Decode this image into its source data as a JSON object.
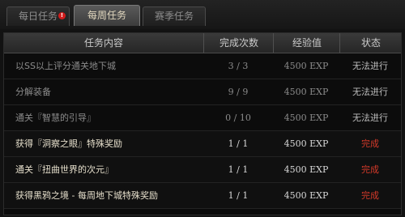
{
  "tabs": [
    {
      "label": "每日任务",
      "active": false,
      "badge": "!"
    },
    {
      "label": "每周任务",
      "active": true
    },
    {
      "label": "赛季任务",
      "active": false
    }
  ],
  "columns": [
    "任务内容",
    "完成次数",
    "经验值",
    "状态"
  ],
  "rows": [
    {
      "name": "以SS以上评分通关地下城",
      "progress": "3 / 3",
      "exp": "4500 EXP",
      "status": "无法进行",
      "state": "unavailable"
    },
    {
      "name": "分解装备",
      "progress": "9 / 9",
      "exp": "4500 EXP",
      "status": "无法进行",
      "state": "unavailable"
    },
    {
      "name": "通关『智慧的引导』",
      "progress": "0 / 10",
      "exp": "4500 EXP",
      "status": "无法进行",
      "state": "unavailable"
    },
    {
      "name": "获得『洞察之眼』特殊奖励",
      "progress": "1 / 1",
      "exp": "4500 EXP",
      "status": "完成",
      "state": "complete"
    },
    {
      "name": "通关『扭曲世界的次元』",
      "progress": "1 / 1",
      "exp": "4500 EXP",
      "status": "完成",
      "state": "complete"
    },
    {
      "name": "获得黑鸦之境 - 每周地下城特殊奖励",
      "progress": "1 / 1",
      "exp": "4500 EXP",
      "status": "完成",
      "state": "complete"
    }
  ],
  "colors": {
    "complete_status": "#d43a2a",
    "unavailable_text": "#8b8b8b"
  }
}
